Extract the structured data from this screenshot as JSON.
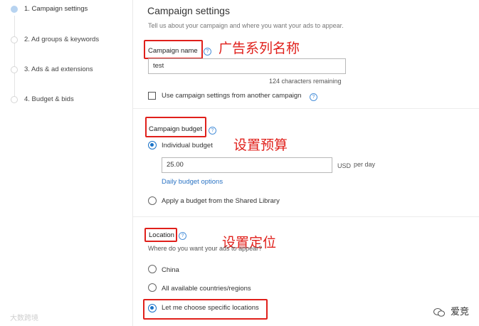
{
  "steps": [
    {
      "label": "1. Campaign settings",
      "active": true
    },
    {
      "label": "2. Ad groups & keywords",
      "active": false
    },
    {
      "label": "3. Ads & ad extensions",
      "active": false
    },
    {
      "label": "4. Budget & bids",
      "active": false
    }
  ],
  "header": {
    "title": "Campaign settings",
    "subtitle": "Tell us about your campaign and where you want your ads to appear."
  },
  "campaign_name": {
    "label": "Campaign name",
    "value": "test",
    "chars_remaining": "124 characters remaining",
    "copy_option": "Use campaign settings from another campaign",
    "annotation": "广告系列名称"
  },
  "budget": {
    "label": "Campaign budget",
    "annotation": "设置预算",
    "individual_label": "Individual budget",
    "amount": "25.00",
    "currency": "USD",
    "period": "per day",
    "options_link": "Daily budget options",
    "shared_label": "Apply a budget from the Shared Library"
  },
  "location": {
    "label": "Location",
    "annotation": "设置定位",
    "question": "Where do you want your ads to appear?",
    "options": [
      "China",
      "All available countries/regions",
      "Let me choose specific locations"
    ]
  },
  "help_glyph": "?",
  "watermark_left": "大数跨境",
  "wechat_name": "爱竞"
}
